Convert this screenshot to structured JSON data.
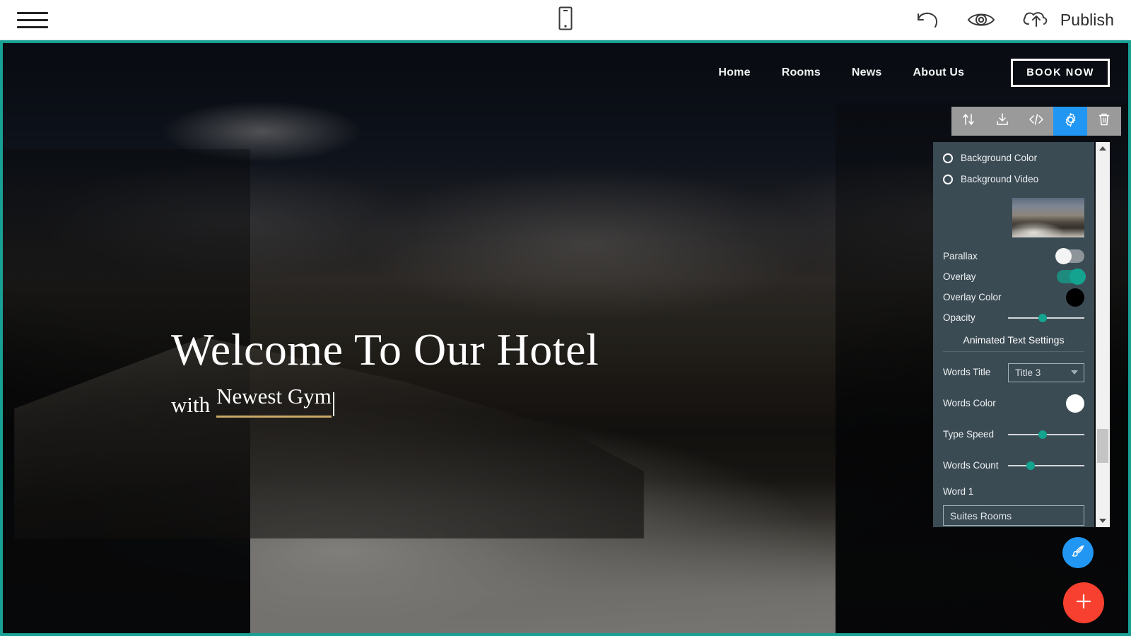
{
  "app_bar": {
    "menu_icon": "hamburger-menu-icon",
    "device_icon": "mobile-device-icon",
    "undo_icon": "undo-icon",
    "preview_icon": "eye-preview-icon",
    "publish_icon": "cloud-upload-icon",
    "publish_label": "Publish"
  },
  "canvas": {
    "border_color": "#17a093",
    "site_nav": {
      "links": [
        {
          "label": "Home"
        },
        {
          "label": "Rooms"
        },
        {
          "label": "News"
        },
        {
          "label": "About Us"
        }
      ],
      "cta_label": "BOOK NOW"
    },
    "hero": {
      "title": "Welcome To Our Hotel",
      "subtitle_static": "with",
      "subtitle_animated": "Newest Gym",
      "underline_color": "#c9a96a"
    }
  },
  "block_toolbar": {
    "buttons": [
      {
        "name": "move-block-button",
        "icon": "up-down-arrows-icon",
        "active": false
      },
      {
        "name": "download-block-button",
        "icon": "download-icon",
        "active": false
      },
      {
        "name": "edit-code-button",
        "icon": "code-brackets-icon",
        "active": false
      },
      {
        "name": "block-settings-button",
        "icon": "gear-icon",
        "active": true
      },
      {
        "name": "delete-block-button",
        "icon": "trash-icon",
        "active": false
      }
    ],
    "active_color": "#2196f3",
    "inactive_color": "#9a9a9a"
  },
  "settings_panel": {
    "background_color_label": "Background Color",
    "background_video_label": "Background Video",
    "background_image_thumb": "background-image-thumbnail",
    "parallax_label": "Parallax",
    "parallax_value": "off",
    "overlay_label": "Overlay",
    "overlay_value": "on",
    "overlay_color_label": "Overlay Color",
    "overlay_color_value": "#000000",
    "opacity_label": "Opacity",
    "opacity_percent": 45,
    "section_title": "Animated Text Settings",
    "words_title_label": "Words Title",
    "words_title_value": "Title 3",
    "words_color_label": "Words Color",
    "words_color_value": "#ffffff",
    "type_speed_label": "Type Speed",
    "type_speed_percent": 45,
    "words_count_label": "Words Count",
    "words_count_percent": 30,
    "word1_label": "Word 1",
    "word1_value": "Suites Rooms",
    "accent_color": "#14a38f",
    "panel_color": "#3b4b54"
  },
  "fabs": {
    "brush_icon": "paint-brush-icon",
    "brush_color": "#2196f3",
    "add_icon": "plus-icon",
    "add_color": "#f7402f"
  }
}
